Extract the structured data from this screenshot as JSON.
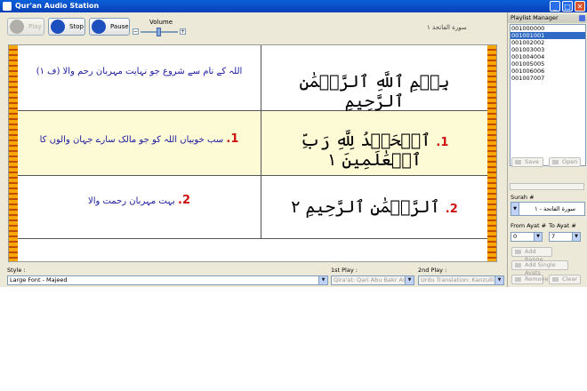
{
  "window": {
    "title": "Qur'an Audio Station"
  },
  "toolbar": {
    "play_label": "Play",
    "stop_label": "Stop",
    "pause_label": "Pause",
    "volume_label": "Volume",
    "volume_minus": "−",
    "volume_plus": "+",
    "surah_title": "سورة الفاتحة ١"
  },
  "verses": [
    {
      "arabic": "بِسۡمِ ٱللَّهِ ٱلرَّحۡمَٰنِ ٱلرَّحِيمِ",
      "urdu": "اللہ کے نام سے شروع جو نہایت مہربان رحم والا (ف ١)",
      "number": ""
    },
    {
      "arabic": "ٱلۡحَمۡدُ لِلَّهِ رَبِّ ٱلۡعَٰلَمِينَ ١",
      "urdu": "سب خوبیاں اللہ کو جو مالک سارے جہان والوں کا",
      "number": "1."
    },
    {
      "arabic": "ٱلرَّحۡمَٰنِ ٱلرَّحِيمِ ٢",
      "urdu": "بہت مہربان رحمت والا",
      "number": "2."
    }
  ],
  "status": {
    "style_label": "Style :",
    "style_value": "Large Font - Majeed",
    "first_play_label": "1st Play :",
    "first_play_value": "Qira'at: Qari Abu Bakr As-Shaatri",
    "second_play_label": "2nd Play :",
    "second_play_value": "Urdu Translation: Kanzulliman"
  },
  "playlist": {
    "title": "Playlist Manager",
    "items": [
      "001000000",
      "001001001",
      "001002002",
      "001003003",
      "001004004",
      "001005005",
      "001006006",
      "001007007"
    ],
    "selected_index": 1,
    "save_label": "Save",
    "open_label": "Open",
    "surah_label": "Surah #",
    "surah_value": "سورة الفاتحة - ١",
    "from_ayat_label": "From Ayat #",
    "to_ayat_label": "To Ayat #",
    "from_ayat_value": "0",
    "to_ayat_value": "7",
    "add_range_label": "Add Range",
    "add_single_label": "Add Single Ayats",
    "remove_label": "Remove",
    "clear_label": "Clear"
  }
}
